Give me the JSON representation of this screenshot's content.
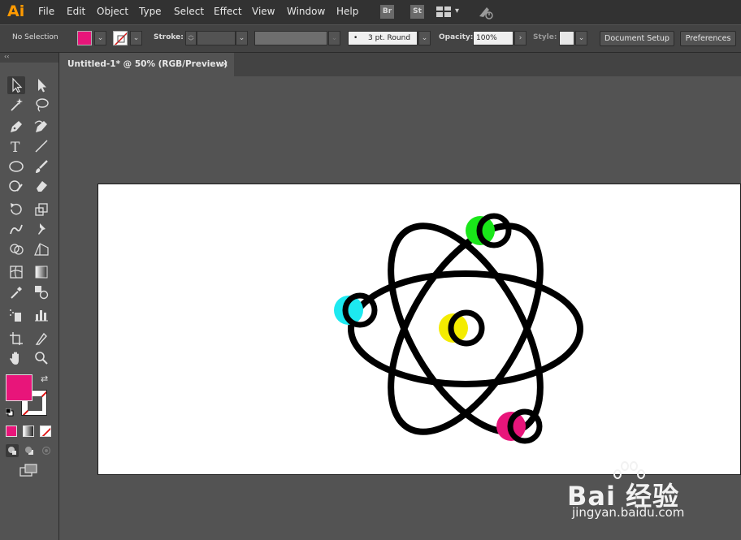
{
  "app": {
    "logo": "Ai"
  },
  "menu": [
    "File",
    "Edit",
    "Object",
    "Type",
    "Select",
    "Effect",
    "View",
    "Window",
    "Help"
  ],
  "menu_icons": {
    "bridge": "Br",
    "stock": "St"
  },
  "controlbar": {
    "selection_status": "No Selection",
    "fill_color": "#e8157a",
    "stroke_label": "Stroke:",
    "brush_label": "3 pt. Round",
    "opacity_label": "Opacity:",
    "opacity_value": "100%",
    "style_label": "Style:",
    "document_setup": "Document Setup",
    "preferences": "Preferences"
  },
  "document": {
    "tab_title": "Untitled-1* @ 50% (RGB/Preview)",
    "tab_close": "×"
  },
  "toolbar": {
    "collapse": "‹‹",
    "fill_color": "#e8157a",
    "stroke": "none"
  },
  "artwork": {
    "colors": {
      "green": "#19e619",
      "cyan": "#1de9f0",
      "yellow": "#f4ec00",
      "magenta": "#e8157a",
      "stroke": "#000000"
    }
  },
  "watermark": {
    "brand": "Bai 经验",
    "url": "jingyan.baidu.com"
  }
}
